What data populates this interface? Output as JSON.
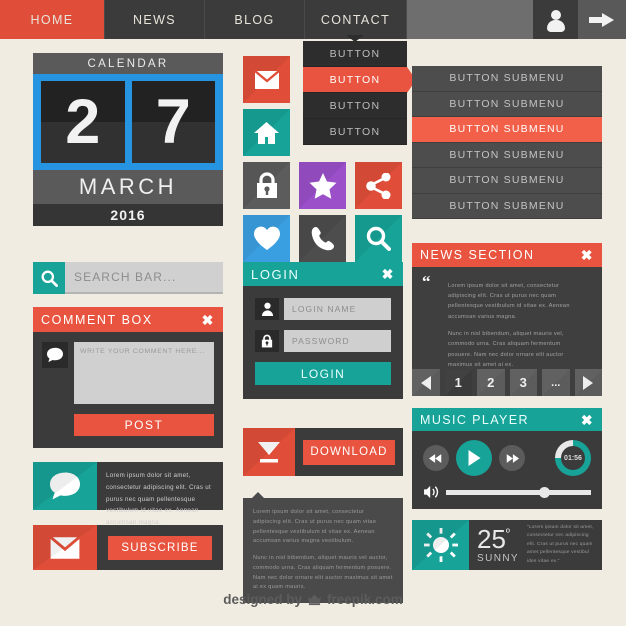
{
  "palette": {
    "background": "#f0ece1",
    "red": "#e04e39",
    "red_light": "#e8543f",
    "teal": "#17a398",
    "blue": "#2694e0",
    "purple": "#9b4fc8",
    "blue_light": "#3a9fe0",
    "dark": "#3b3b3b",
    "darker": "#2d2d2d",
    "gray": "#5c5c5c"
  },
  "topnav": {
    "items": [
      {
        "label": "HOME",
        "active": true
      },
      {
        "label": "NEWS",
        "active": false
      },
      {
        "label": "BLOG",
        "active": false
      },
      {
        "label": "CONTACT",
        "active": false
      }
    ],
    "user_icon": "user-icon",
    "arrow_icon": "arrow-right-icon"
  },
  "dropdown": {
    "items": [
      {
        "label": "BUTTON",
        "active": false
      },
      {
        "label": "BUTTON",
        "active": true
      },
      {
        "label": "BUTTON",
        "active": false
      },
      {
        "label": "BUTTON",
        "active": false
      }
    ]
  },
  "submenu": {
    "items": [
      {
        "label": "BUTTON SUBMENU",
        "active": false
      },
      {
        "label": "BUTTON SUBMENU",
        "active": false
      },
      {
        "label": "BUTTON SUBMENU",
        "active": true
      },
      {
        "label": "BUTTON SUBMENU",
        "active": false
      },
      {
        "label": "BUTTON SUBMENU",
        "active": false
      },
      {
        "label": "BUTTON SUBMENU",
        "active": false
      }
    ]
  },
  "calendar": {
    "title": "CALENDAR",
    "digit_first": "2",
    "digit_second": "7",
    "month": "MARCH",
    "year": "2016"
  },
  "icon_grid": {
    "icons": [
      {
        "name": "mail-icon",
        "color": "#e04e39"
      },
      {
        "name": "home-icon",
        "color": "#17a398"
      },
      {
        "name": "lock-icon",
        "color": "#5c5c5c"
      },
      {
        "name": "star-icon",
        "color": "#9b4fc8"
      },
      {
        "name": "share-icon",
        "color": "#e04e39"
      },
      {
        "name": "heart-icon",
        "color": "#3a9fe0"
      },
      {
        "name": "phone-icon",
        "color": "#4d4d4d"
      },
      {
        "name": "search-icon",
        "color": "#17a398"
      }
    ]
  },
  "search": {
    "placeholder": "SEARCH BAR...",
    "icon": "search-icon"
  },
  "comment_box": {
    "title": "COMMENT BOX",
    "close": "✖",
    "textarea_placeholder": "WRITE YOUR COMMENT HERE...",
    "post_label": "POST",
    "avatar_icon": "speech-bubble-icon"
  },
  "login": {
    "title": "LOGIN",
    "close": "✖",
    "username_placeholder": "LOGIN NAME",
    "password_placeholder": "PASSWORD",
    "button_label": "LOGIN",
    "user_icon": "user-icon",
    "lock_icon": "lock-icon"
  },
  "download": {
    "button_label": "DOWNLOAD",
    "icon": "download-icon"
  },
  "paragraph_card": {
    "p1": "Lorem ipsum dolor sit amet, consectetur adipiscing elit. Cras ut purus nec quam vitae pellentesque vestibulum id vitae ex. Aenean accumsan varius magna vestibulum.",
    "p2": "Nunc in nisl bibendum, aliquet mauris vel auctor, commodo urna. Cras aliquam fermentum posuere. Nam nec dolor ornare elit auctor maximus sit amet ai ex quam mauris."
  },
  "speech_card": {
    "text": "Lorem ipsum dolor sit amet, consectetur adipiscing elit. Cras ut purus nec quam pellentesque vestibulum id vitae ex. Aenean accumsan magna.",
    "icon": "speech-bubble-icon"
  },
  "subscribe": {
    "button_label": "SUBSCRIBE",
    "icon": "mail-icon"
  },
  "news": {
    "title": "NEWS SECTION",
    "close": "✖",
    "quote_open": "“",
    "quote_close": "”",
    "p1": "Lorem ipsum dolor sit amet, consectetur adipiscing elit. Cras ut purus nec quam pellentesque vestibulum id vitae ex. Aenean accumsan varius magna.",
    "p2": "Nunc in nisl bibendum, aliquet mauris vel, commodo urna. Cras aliquam fermentum posuere. Nam nec dolor ornare elit auctor maximus sit amet ai ex."
  },
  "pagination": {
    "prev_icon": "triangle-left-icon",
    "next_icon": "triangle-right-icon",
    "pages": [
      {
        "label": "1",
        "active": true
      },
      {
        "label": "2",
        "active": false
      },
      {
        "label": "3",
        "active": false
      },
      {
        "label": "...",
        "active": false
      }
    ]
  },
  "music_player": {
    "title": "MUSIC PLAYER",
    "close": "✖",
    "rewind_icon": "rewind-icon",
    "play_icon": "play-icon",
    "forward_icon": "fast-forward-icon",
    "timer": "01:56",
    "progress_percent": 75,
    "volume_icon": "volume-icon",
    "volume_percent": 64
  },
  "weather": {
    "temperature": "25",
    "degree": "º",
    "condition": "SUNNY",
    "text": "“Lorem ipsum dolor sit amet, consectetur nec adipiscing elit. Cras ut purus nec quam amet pellentesque vestibul ides vitae ex.”",
    "icon": "sun-icon"
  },
  "footer": {
    "prefix": "designed by",
    "brand": "freepik.com",
    "logo_icon": "freepik-crown-icon"
  }
}
